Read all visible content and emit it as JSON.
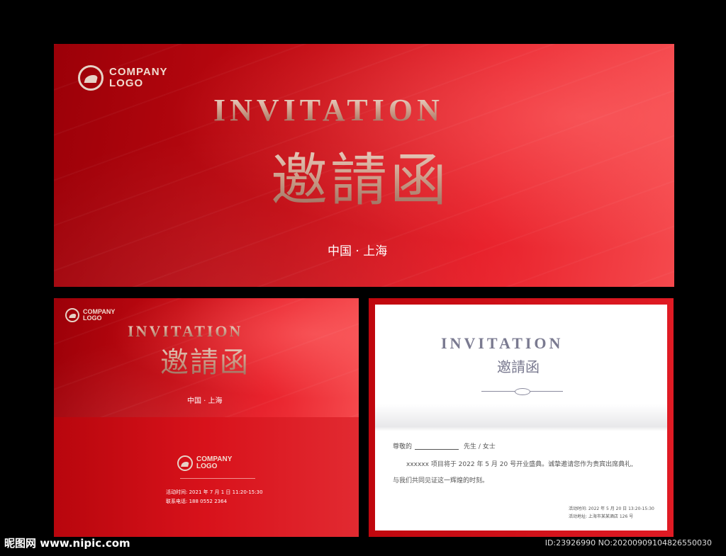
{
  "logo": {
    "line1": "COMPANY",
    "line2": "LOGO"
  },
  "banner": {
    "title_en": "INVITATION",
    "title_cn": "邀請函",
    "location": "中国 · 上海"
  },
  "cover": {
    "title_en": "INVITATION",
    "title_cn": "邀請函",
    "location": "中国 · 上海",
    "event_time": "活动时间: 2021 年 7 月 1 日 11:20-15:30",
    "contact": "联系电话: 188 0552 2364"
  },
  "inside": {
    "title_en": "INVITATION",
    "title_cn": "邀請函",
    "greeting_prefix": "尊敬的",
    "greeting_suffix": "先生 / 女士",
    "body_line1": "xxxxxx 项目将于 2022 年 5 月 20 号开业盛典。诚挚邀请您作为贵宾出席典礼,",
    "body_line2": "与我们共同见证这一辉煌的时刻。",
    "event_time": "活动时间: 2022 年 5 月 20 日 13:20-15:30",
    "event_place": "活动地址: 上海市某某酒店 126 号"
  },
  "watermark": {
    "left": "昵图网 www.nipic.com",
    "right": "ID:23926990 NO:20200909104826550030"
  },
  "colors": {
    "red": "#c30a12",
    "gold": "#d8b7a6",
    "grey_title": "#7a7a90"
  }
}
